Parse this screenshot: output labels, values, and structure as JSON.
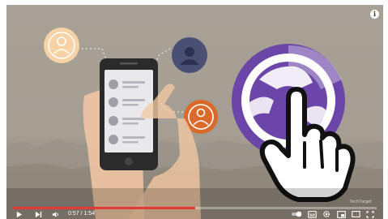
{
  "player": {
    "current_time": "0:57",
    "separator": " / ",
    "duration": "1:54",
    "progress": 0.5,
    "watermark": "TechTarget",
    "info_label": "i"
  },
  "colors": {
    "accent": "#e53935",
    "purple": "#6b45a8",
    "peach": "#f6d2a4",
    "navy": "#4a4f74",
    "orange": "#d96a2a"
  },
  "icons": [
    "info-icon",
    "play-icon",
    "next-icon",
    "volume-icon",
    "autoplay-toggle",
    "subtitles-icon",
    "settings-icon",
    "miniplayer-icon",
    "theater-icon",
    "fullscreen-icon"
  ]
}
